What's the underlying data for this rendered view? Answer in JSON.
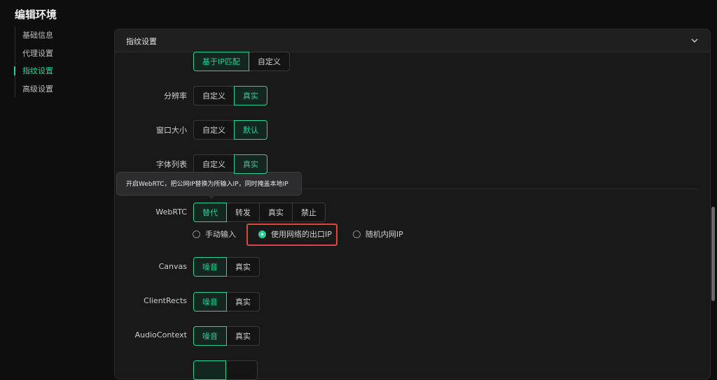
{
  "page_title": "编辑环境",
  "sidebar": {
    "items": [
      {
        "label": "基础信息"
      },
      {
        "label": "代理设置"
      },
      {
        "label": "指纹设置"
      },
      {
        "label": "高级设置"
      }
    ]
  },
  "panel": {
    "title": "指纹设置"
  },
  "colors": {
    "accent": "#2bd09a",
    "highlight": "#e04444",
    "background": "#0e0e0f",
    "panel": "#19191a"
  },
  "rows": {
    "timezone": {
      "options": [
        "基于IP匹配",
        "自定义"
      ],
      "selected": "基于IP匹配"
    },
    "resolution": {
      "label": "分辨率",
      "options": [
        "自定义",
        "真实"
      ],
      "selected": "真实"
    },
    "window_size": {
      "label": "窗口大小",
      "options": [
        "自定义",
        "默认"
      ],
      "selected": "默认"
    },
    "font_list": {
      "label": "字体列表",
      "options": [
        "自定义",
        "真实"
      ],
      "selected": "真实"
    },
    "webrtc": {
      "label": "WebRTC",
      "options": [
        "替代",
        "转发",
        "真实",
        "禁止"
      ],
      "selected": "替代",
      "tooltip": "开启WebRTC，把公网IP替换为所输入IP，同时掩盖本地IP",
      "radios": [
        "手动输入",
        "使用网络的出口IP",
        "随机内网IP"
      ],
      "radio_selected": "使用网络的出口IP"
    },
    "canvas": {
      "label": "Canvas",
      "options": [
        "噪音",
        "真实"
      ],
      "selected": "噪音"
    },
    "client_rects": {
      "label": "ClientRects",
      "options": [
        "噪音",
        "真实"
      ],
      "selected": "噪音"
    },
    "audio_context": {
      "label": "AudioContext",
      "options": [
        "噪音",
        "真实"
      ],
      "selected": "噪音"
    }
  }
}
